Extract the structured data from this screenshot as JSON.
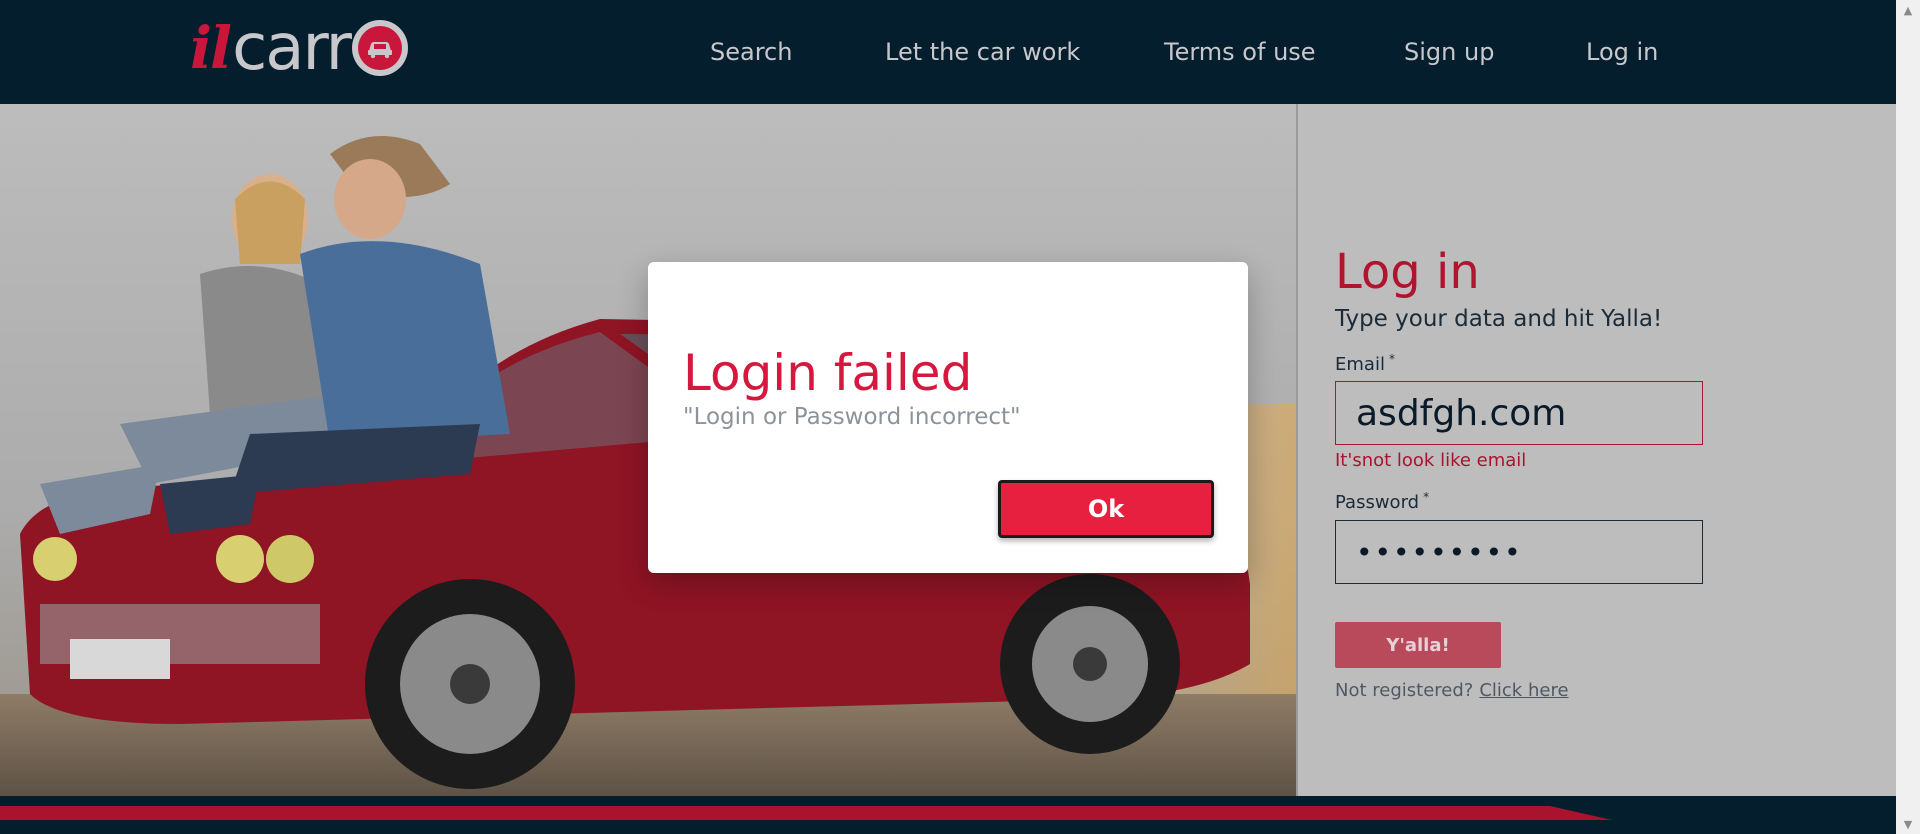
{
  "header": {
    "logo": {
      "il": "il",
      "carr": "carr"
    },
    "nav": [
      {
        "label": "Search"
      },
      {
        "label": "Let the car work"
      },
      {
        "label": "Terms of use"
      },
      {
        "label": "Sign up"
      },
      {
        "label": "Log in"
      }
    ]
  },
  "login": {
    "title": "Log in",
    "subtitle": "Type your data and hit Yalla!",
    "email_label": "Email",
    "required_mark": "*",
    "email_value": "asdfgh.com",
    "email_error": "It'snot look like email",
    "password_label": "Password",
    "password_value": "•••••••••",
    "submit_label": "Y'alla!",
    "not_registered": "Not registered?",
    "register_link": "Click here"
  },
  "modal": {
    "title": "Login failed",
    "message": "\"Login or Password incorrect\"",
    "ok_label": "Ok"
  },
  "colors": {
    "header_bg": "#051e2e",
    "accent_red": "#d5183d",
    "nav_text": "#c8c8cc"
  }
}
